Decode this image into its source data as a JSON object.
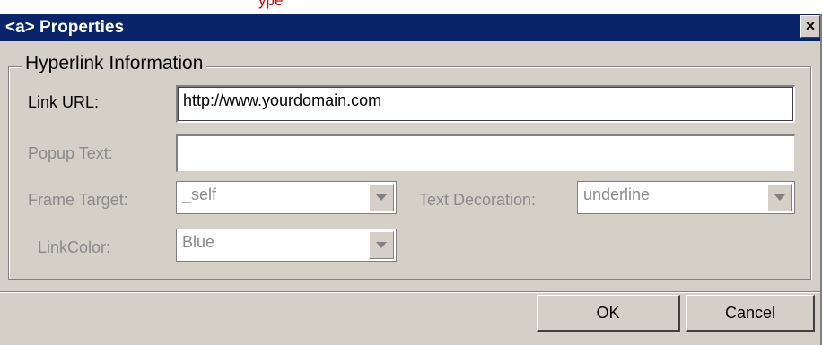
{
  "window": {
    "title": "<a> Properties",
    "close_glyph": "×"
  },
  "group": {
    "legend": "Hyperlink Information"
  },
  "fields": {
    "link_url": {
      "label": "Link URL:",
      "value": "http://www.yourdomain.com"
    },
    "popup_text": {
      "label": "Popup Text:",
      "value": ""
    },
    "frame_target": {
      "label": "Frame Target:",
      "value": "_self"
    },
    "text_decoration": {
      "label": "Text Decoration:",
      "value": "underline"
    },
    "link_color": {
      "label": "LinkColor:",
      "value": "Blue"
    }
  },
  "buttons": {
    "ok": "OK",
    "cancel": "Cancel"
  },
  "icons": {
    "close": "close-icon",
    "dropdown": "chevron-down-icon"
  },
  "colors": {
    "titlebar": "#0a246a",
    "dialog_bg": "#d4d0c8",
    "disabled_text": "#8a8a8a"
  }
}
